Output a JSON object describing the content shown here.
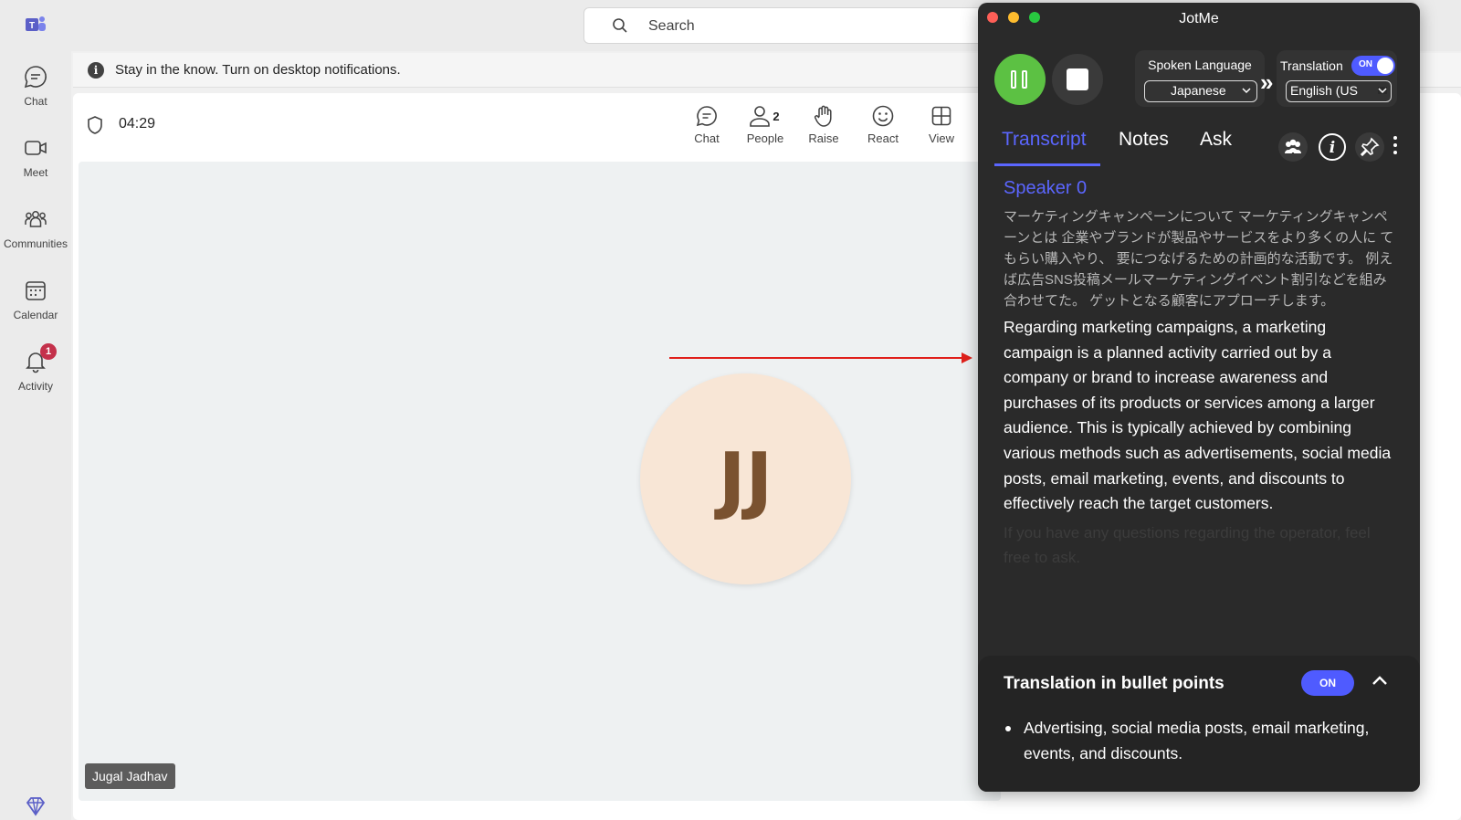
{
  "rail": {
    "items": [
      {
        "label": "Chat"
      },
      {
        "label": "Meet"
      },
      {
        "label": "Communities"
      },
      {
        "label": "Calendar"
      },
      {
        "label": "Activity",
        "badge": "1"
      }
    ]
  },
  "search": {
    "placeholder": "Search"
  },
  "notification": {
    "text": "Stay in the know. Turn on desktop notifications.",
    "icon": "i"
  },
  "meeting": {
    "timer": "04:29",
    "tools": [
      {
        "label": "Chat"
      },
      {
        "label": "People",
        "count": "2"
      },
      {
        "label": "Raise"
      },
      {
        "label": "React"
      },
      {
        "label": "View"
      }
    ],
    "participant_initials": "JJ",
    "participant_name": "Jugal Jadhav"
  },
  "jotme": {
    "title": "JotMe",
    "spoken_language_label": "Spoken Language",
    "spoken_language_value": "Japanese",
    "translation_label": "Translation",
    "translation_toggle": "ON",
    "translation_value": "English (US",
    "tabs": [
      "Transcript",
      "Notes",
      "Ask"
    ],
    "speaker": "Speaker 0",
    "japanese_text": "マーケティングキャンペーンについて マーケティングキャンペーンとは 企業やブランドが製品やサービスをより多くの人に てもらい購入やり、 要につなげるための計画的な活動です。 例えば広告SNS投稿メールマーケティングイベント割引などを組み合わせてた。 ゲットとなる顧客にアプローチします。",
    "english_text": "Regarding marketing campaigns, a marketing campaign is a planned activity carried out by a company or brand to increase awareness and purchases of its products or services among a larger audience. This is typically achieved by combining various methods such as advertisements, social media posts, email marketing, events, and discounts to effectively reach the target customers.",
    "ghost_text": "If you have any questions regarding the operator, feel free to ask.",
    "bullets_title": "Translation in bullet points",
    "bullets_toggle": "ON",
    "bullets": [
      "Advertising, social media posts, email marketing, events, and discounts."
    ]
  },
  "colors": {
    "accent": "#5b66ff",
    "teams_purple": "#5b5fc7",
    "record_green": "#5cc143",
    "arrow_red": "#e0201b"
  }
}
